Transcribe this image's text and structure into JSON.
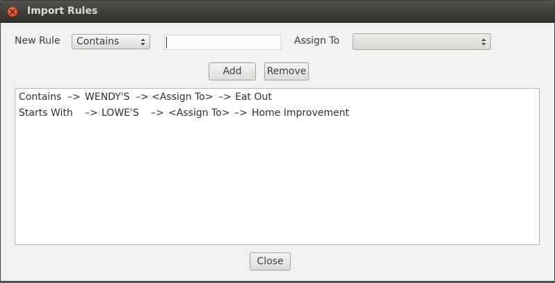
{
  "window": {
    "title": "Import Rules"
  },
  "form": {
    "new_rule_label": "New Rule",
    "match_type_selected": "Contains",
    "pattern_value": "",
    "assign_to_label": "Assign To",
    "assign_to_selected": ""
  },
  "buttons": {
    "add": "Add",
    "remove": "Remove",
    "close": "Close"
  },
  "rules": [
    {
      "match_type": "Contains",
      "arrow1": "–>",
      "pattern": "WENDY'S",
      "arrow2": "–>",
      "assign_to": "<Assign To>",
      "arrow3": "–>",
      "category": "Eat Out"
    },
    {
      "match_type": "Starts With",
      "arrow1": "–>",
      "pattern": "LOWE'S",
      "arrow2": "–>",
      "assign_to": "<Assign To>",
      "arrow3": "–>",
      "category": "Home Improvement"
    }
  ],
  "icons": {
    "close": "close-icon",
    "combo_arrows": "updown-arrows-icon"
  },
  "colors": {
    "titlebar": "#3c3b37",
    "close_button": "#e0552b",
    "window_bg": "#f2f1f0"
  }
}
